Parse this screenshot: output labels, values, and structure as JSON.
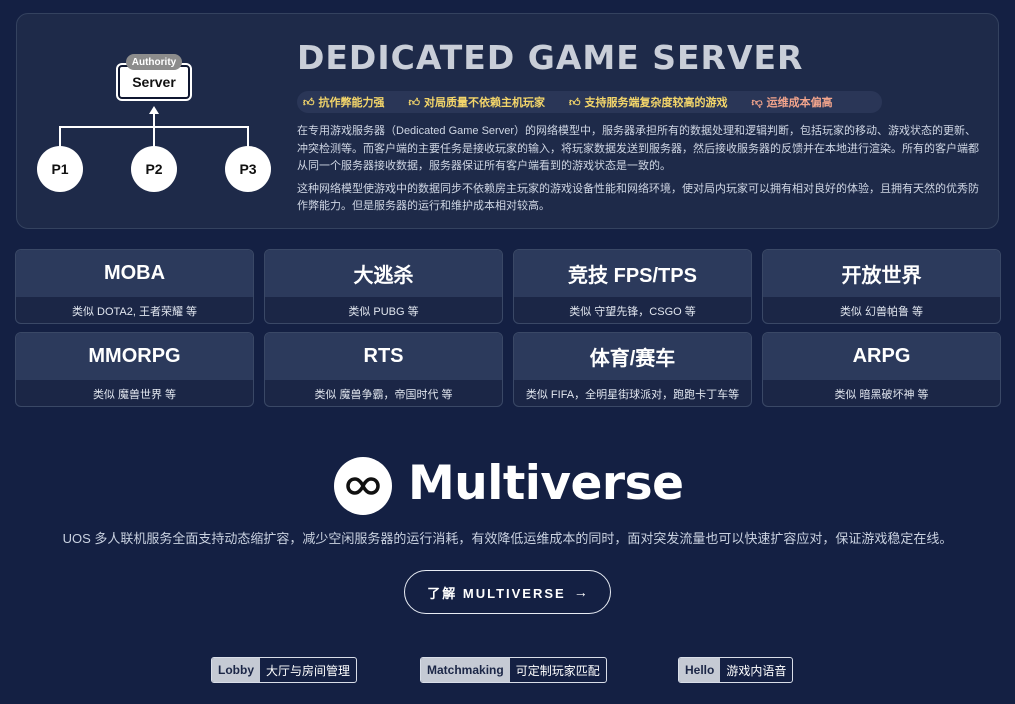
{
  "diagram": {
    "authority_label": "Authority",
    "server_label": "Server",
    "players": [
      "P1",
      "P2",
      "P3"
    ]
  },
  "hero": {
    "title": "DEDICATED GAME SERVER",
    "tags": [
      {
        "icon": "thumbs-up-icon",
        "label": "抗作弊能力强"
      },
      {
        "icon": "thumbs-up-icon",
        "label": "对局质量不依赖主机玩家"
      },
      {
        "icon": "thumbs-up-icon",
        "label": "支持服务端复杂度较高的游戏"
      },
      {
        "icon": "thumbs-down-icon",
        "label": "运维成本偏高"
      }
    ],
    "paragraph_1": "在专用游戏服务器（Dedicated Game Server）的网络模型中，服务器承担所有的数据处理和逻辑判断，包括玩家的移动、游戏状态的更新、冲突检测等。而客户端的主要任务是接收玩家的输入，将玩家数据发送到服务器，然后接收服务器的反馈并在本地进行渲染。所有的客户端都从同一个服务器接收数据，服务器保证所有客户端看到的游戏状态是一致的。",
    "paragraph_2": "这种网络模型使游戏中的数据同步不依赖房主玩家的游戏设备性能和网络环境，使对局内玩家可以拥有相对良好的体验，且拥有天然的优秀防作弊能力。但是服务器的运行和维护成本相对较高。"
  },
  "genres": [
    {
      "title": "MOBA",
      "sub": "类似 DOTA2, 王者荣耀 等"
    },
    {
      "title": "大逃杀",
      "sub": "类似 PUBG 等"
    },
    {
      "title": "竞技 FPS/TPS",
      "sub": "类似 守望先锋，CSGO 等"
    },
    {
      "title": "开放世界",
      "sub": "类似 幻兽帕鲁 等"
    },
    {
      "title": "MMORPG",
      "sub": "类似 魔兽世界 等"
    },
    {
      "title": "RTS",
      "sub": "类似 魔兽争霸，帝国时代 等"
    },
    {
      "title": "体育/赛车",
      "sub": "类似 FIFA，全明星街球派对，跑跑卡丁车等"
    },
    {
      "title": "ARPG",
      "sub": "类似 暗黑破坏神 等"
    }
  ],
  "multiverse": {
    "logo_icon": "infinity-icon",
    "title": "Multiverse",
    "description": "UOS 多人联机服务全面支持动态缩扩容，减少空闲服务器的运行消耗，有效降低运维成本的同时，面对突发流量也可以快速扩容应对，保证游戏稳定在线。",
    "cta_label": "了解 MULTIVERSE",
    "cta_arrow": "→"
  },
  "features": [
    {
      "key": "Lobby",
      "value": "大厅与房间管理"
    },
    {
      "key": "Matchmaking",
      "value": "可定制玩家匹配"
    },
    {
      "key": "Hello",
      "value": "游戏内语音"
    }
  ]
}
